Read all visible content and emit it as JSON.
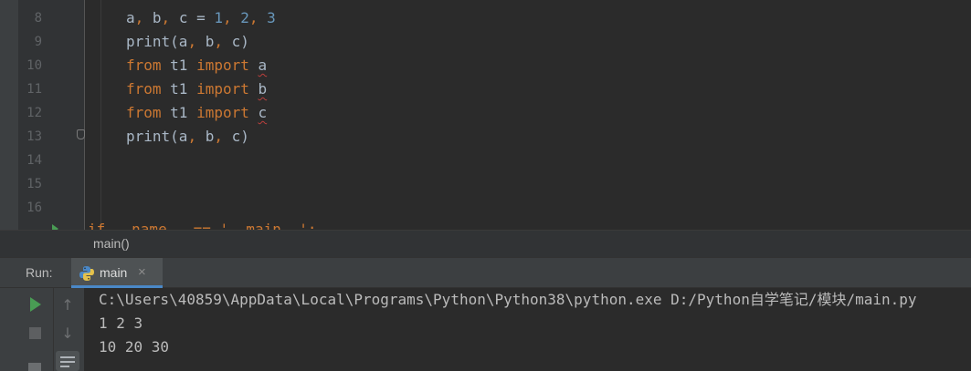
{
  "editor": {
    "lines": [
      {
        "n": "8",
        "tokens": [
          {
            "t": "a",
            "c": "id"
          },
          {
            "t": ", ",
            "c": "kw"
          },
          {
            "t": "b",
            "c": "id"
          },
          {
            "t": ", ",
            "c": "kw"
          },
          {
            "t": "c = ",
            "c": "id"
          },
          {
            "t": "1",
            "c": "num"
          },
          {
            "t": ", ",
            "c": "kw"
          },
          {
            "t": "2",
            "c": "num"
          },
          {
            "t": ", ",
            "c": "kw"
          },
          {
            "t": "3",
            "c": "num"
          }
        ]
      },
      {
        "n": "9",
        "tokens": [
          {
            "t": "print(a",
            "c": "id"
          },
          {
            "t": ", ",
            "c": "kw"
          },
          {
            "t": "b",
            "c": "id"
          },
          {
            "t": ", ",
            "c": "kw"
          },
          {
            "t": "c)",
            "c": "id"
          }
        ]
      },
      {
        "n": "10",
        "tokens": [
          {
            "t": "from ",
            "c": "kw"
          },
          {
            "t": "t1 ",
            "c": "id"
          },
          {
            "t": "import ",
            "c": "kw"
          },
          {
            "t": "a",
            "c": "warn"
          }
        ]
      },
      {
        "n": "11",
        "tokens": [
          {
            "t": "from ",
            "c": "kw"
          },
          {
            "t": "t1 ",
            "c": "id"
          },
          {
            "t": "import ",
            "c": "kw"
          },
          {
            "t": "b",
            "c": "warn"
          }
        ]
      },
      {
        "n": "12",
        "tokens": [
          {
            "t": "from ",
            "c": "kw"
          },
          {
            "t": "t1 ",
            "c": "id"
          },
          {
            "t": "import ",
            "c": "kw"
          },
          {
            "t": "c",
            "c": "warn"
          }
        ]
      },
      {
        "n": "13",
        "tokens": [
          {
            "t": "print(a",
            "c": "id"
          },
          {
            "t": ", ",
            "c": "kw"
          },
          {
            "t": "b",
            "c": "id"
          },
          {
            "t": ", ",
            "c": "kw"
          },
          {
            "t": "c)",
            "c": "id"
          }
        ]
      },
      {
        "n": "14",
        "tokens": []
      },
      {
        "n": "15",
        "tokens": []
      },
      {
        "n": "16",
        "tokens": []
      }
    ]
  },
  "breadcrumb": "main()",
  "run_panel": {
    "label": "Run:",
    "tab_label": "main",
    "close_glyph": "×",
    "up_glyph": "↑",
    "down_glyph": "↓",
    "console": [
      "C:\\Users\\40859\\AppData\\Local\\Programs\\Python\\Python38\\python.exe D:/Python自学笔记/模块/main.py",
      "1 2 3",
      "10 20 30"
    ]
  },
  "colors": {
    "keyword": "#cc7832",
    "number": "#6897bb",
    "text": "#a9b7c6",
    "run_green": "#499c54",
    "tab_underline": "#4a88c7"
  }
}
